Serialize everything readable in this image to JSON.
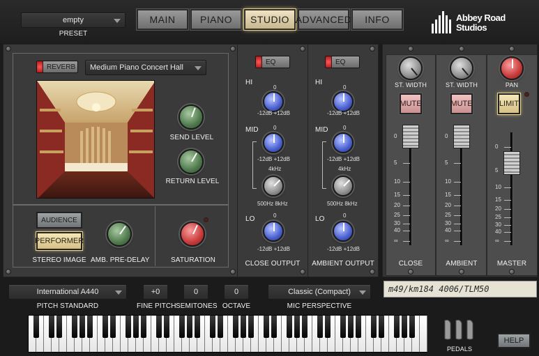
{
  "preset": {
    "value": "empty",
    "label": "PRESET"
  },
  "nav_tabs": [
    "MAIN",
    "PIANO",
    "STUDIO",
    "ADVANCED",
    "INFO"
  ],
  "brand": {
    "line1": "Abbey Road",
    "line2": "Studios"
  },
  "reverb": {
    "toggle_label": "REVERB",
    "room": "Medium Piano Concert Hall",
    "send_label": "SEND LEVEL",
    "return_label": "RETURN LEVEL"
  },
  "stereo": {
    "audience_label": "AUDIENCE",
    "performer_label": "PERFORMER",
    "title": "STEREO IMAGE",
    "predelay_label": "AMB. PRE-DELAY",
    "saturation_label": "SATURATION"
  },
  "eq_close": {
    "toggle_label": "EQ",
    "hi": "HI",
    "mid": "MID",
    "lo": "LO",
    "zero": "0",
    "range": "-12dB +12dB",
    "freq_center": "4kHz",
    "freq_range": "500Hz 8kHz",
    "title": "CLOSE OUTPUT"
  },
  "eq_ambient": {
    "toggle_label": "EQ",
    "hi": "HI",
    "mid": "MID",
    "lo": "LO",
    "zero": "0",
    "range": "-12dB +12dB",
    "freq_center": "4kHz",
    "freq_range": "500Hz 8kHz",
    "title": "AMBIENT OUTPUT"
  },
  "mixer": {
    "width_label": "ST. WIDTH",
    "pan_label": "PAN",
    "mute_label": "MUTE",
    "limit_label": "LIMIT",
    "close_label": "CLOSE",
    "ambient_label": "AMBIENT",
    "master_label": "MASTER",
    "scale": [
      "0",
      "5",
      "10",
      "15",
      "20",
      "25",
      "30",
      "40",
      "∞"
    ]
  },
  "mic_note": "m49/km184 4006/TLM50",
  "bottom": {
    "pitch_standard": "International A440",
    "pitch_standard_label": "PITCH STANDARD",
    "fine_pitch": "+0",
    "fine_pitch_label": "FINE PITCH",
    "semitones": "0",
    "semitones_label": "SEMITONES",
    "octave": "0",
    "octave_label": "OCTAVE",
    "mic_perspective": "Classic (Compact)",
    "mic_perspective_label": "MIC PERSPECTIVE",
    "pedals_label": "PEDALS",
    "help_label": "HELP"
  },
  "colors": {
    "accent_active": "#e6cf86",
    "led_red": "#e03030",
    "knob_blue": "#4a5fd0",
    "knob_green": "#4f7a4d",
    "knob_red": "#c93a3a"
  }
}
